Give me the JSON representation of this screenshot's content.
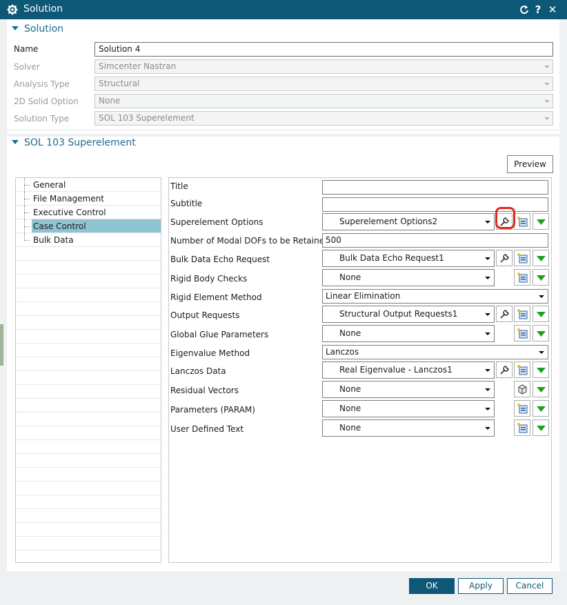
{
  "window": {
    "title": "Solution"
  },
  "section1": {
    "heading": "Solution",
    "name_label": "Name",
    "name_value": "Solution 4",
    "solver_label": "Solver",
    "solver_value": "Simcenter Nastran",
    "analysis_label": "Analysis Type",
    "analysis_value": "Structural",
    "solid_label": "2D Solid Option",
    "solid_value": "None",
    "type_label": "Solution Type",
    "type_value": "SOL 103 Superelement"
  },
  "section2": {
    "heading": "SOL 103 Superelement",
    "preview_label": "Preview"
  },
  "tree": {
    "items": [
      "General",
      "File Management",
      "Executive Control",
      "Case Control",
      "Bulk Data"
    ],
    "selected": "Case Control"
  },
  "props": {
    "title_label": "Title",
    "title_value": "",
    "subtitle_label": "Subtitle",
    "subtitle_value": "",
    "superelement_label": "Superelement Options",
    "superelement_value": "Superelement Options2",
    "modal_label": "Number of Modal DOFs to be Retained",
    "modal_value": "500",
    "bulkecho_label": "Bulk Data Echo Request",
    "bulkecho_value": "Bulk Data Echo Request1",
    "rigidbody_label": "Rigid Body Checks",
    "rigidbody_value": "None",
    "rigidelem_label": "Rigid Element Method",
    "rigidelem_value": "Linear Elimination",
    "output_label": "Output Requests",
    "output_value": "Structural Output Requests1",
    "glue_label": "Global Glue Parameters",
    "glue_value": "None",
    "eigen_label": "Eigenvalue Method",
    "eigen_value": "Lanczos",
    "lanczos_label": "Lanczos Data",
    "lanczos_value": "Real Eigenvalue - Lanczos1",
    "residual_label": "Residual Vectors",
    "residual_value": "None",
    "param_label": "Parameters (PARAM)",
    "param_value": "None",
    "userdef_label": "User Defined Text",
    "userdef_value": "None"
  },
  "footer": {
    "ok": "OK",
    "apply": "Apply",
    "cancel": "Cancel"
  },
  "colors": {
    "titlebar": "#0e5877",
    "accent": "#1c6b8c",
    "selection": "#8ec3d1",
    "highlight": "#e0261e",
    "green": "#1aa31a"
  }
}
